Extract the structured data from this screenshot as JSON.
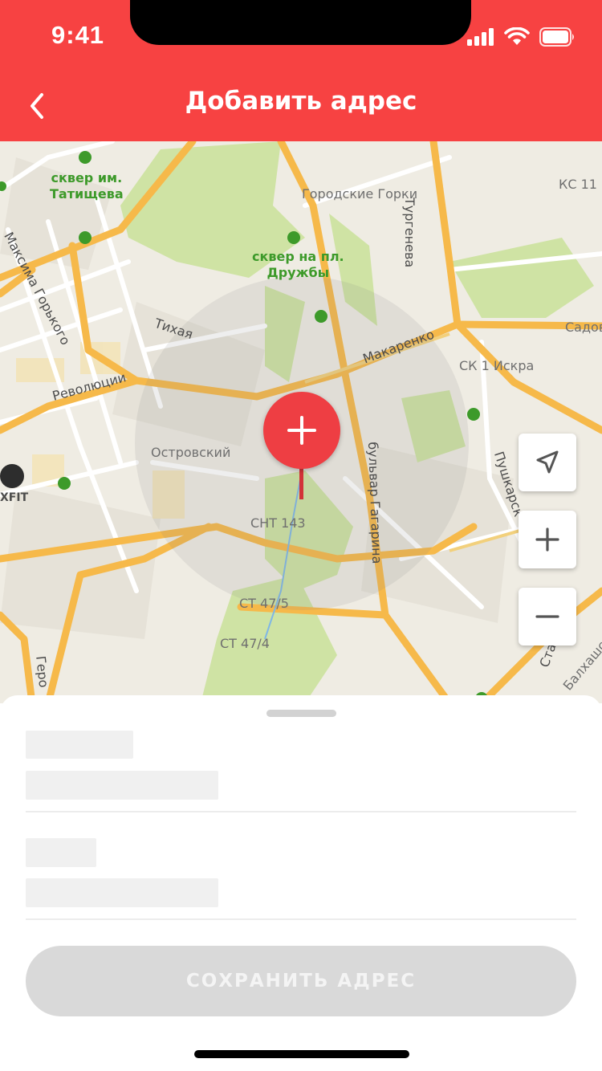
{
  "status_bar": {
    "time": "9:41"
  },
  "header": {
    "title": "Добавить адрес"
  },
  "map": {
    "labels": {
      "skver_tatishcheva": "сквер им.\nТатищева",
      "gorodskie_gorki": "Городские Горки",
      "turgeneva": "Тургенева",
      "ks11": "КС 11",
      "maksima_gorkogo": "Максима Горького",
      "skver_druzhby": "сквер на пл.\nДружбы",
      "tikhaya": "Тихая",
      "makarenko": "Макаренко",
      "sadov": "Садов",
      "revolyutsii": "Революции",
      "sk_iskra": "СК 1 Искра",
      "ostrovskiy": "Островский",
      "bulvar_gagarina": "бульвар Гагарина",
      "pushkarskaya": "Пушкарск",
      "xfit": "XFIT",
      "snt143": "СНТ 143",
      "st475": "СТ 47/5",
      "st474": "СТ 47/4",
      "gero": "Геро",
      "star": "Стар",
      "balkhash": "Балхашск"
    },
    "controls": {
      "locate_icon": "navigation-arrow-icon",
      "zoom_in_icon": "plus-icon",
      "zoom_out_icon": "minus-icon"
    },
    "pin_icon": "plus-icon"
  },
  "sheet": {
    "save_button": "СОХРАНИТЬ АДРЕС"
  },
  "colors": {
    "accent": "#f74242",
    "pin": "#ee3e43",
    "button_disabled": "#d9d9d9",
    "skeleton": "#f0f0f0"
  }
}
